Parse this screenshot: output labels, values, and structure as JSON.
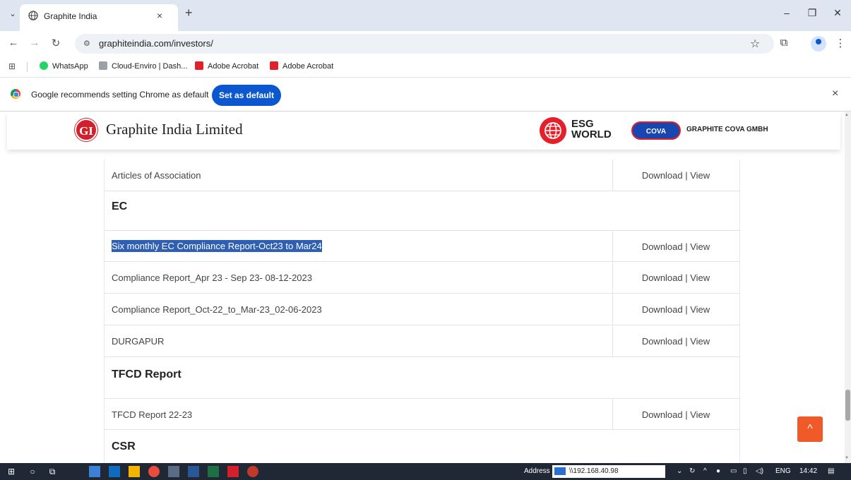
{
  "browser": {
    "tab_title": "Graphite India",
    "tab_close": "×",
    "new_tab": "+",
    "url": "graphiteindia.com/investors/",
    "window_controls": {
      "minimize": "–",
      "restore": "❐",
      "close": "✕"
    }
  },
  "bookmarks": [
    {
      "label": "WhatsApp",
      "color": "#25d366"
    },
    {
      "label": "Cloud-Enviro | Dash...",
      "color": "#9aa0a6"
    },
    {
      "label": "Adobe Acrobat",
      "color": "#e0202a"
    },
    {
      "label": "Adobe Acrobat",
      "color": "#e0202a"
    }
  ],
  "infobar": {
    "message": "Google recommends setting Chrome as default",
    "button": "Set as default",
    "close": "×"
  },
  "site_header": {
    "logo_text": "GI",
    "company_name": "Graphite India Limited",
    "esg_line1": "ESG",
    "esg_line2": "WORLD",
    "cova_badge": "COVA",
    "cova_name": "GRAPHITE COVA GMBH"
  },
  "documents": {
    "action_label": "Download | View",
    "top_row": "Articles of Association",
    "sections": [
      {
        "heading": "EC",
        "rows": [
          "Six monthly EC Compliance Report-Oct23 to Mar24",
          "Compliance Report_Apr 23 - Sep 23- 08-12-2023",
          "Compliance Report_Oct-22_to_Mar-23_02-06-2023",
          "DURGAPUR"
        ]
      },
      {
        "heading": "TFCD Report",
        "rows": [
          "TFCD Report 22-23"
        ]
      },
      {
        "heading": "CSR",
        "rows": []
      }
    ],
    "selected_row": "Six monthly EC Compliance Report-Oct23 to Mar24"
  },
  "back_to_top": "^",
  "taskbar": {
    "address_label": "Address",
    "address_value": "\\\\192.168.40.98",
    "language": "ENG",
    "time": "14:42"
  }
}
